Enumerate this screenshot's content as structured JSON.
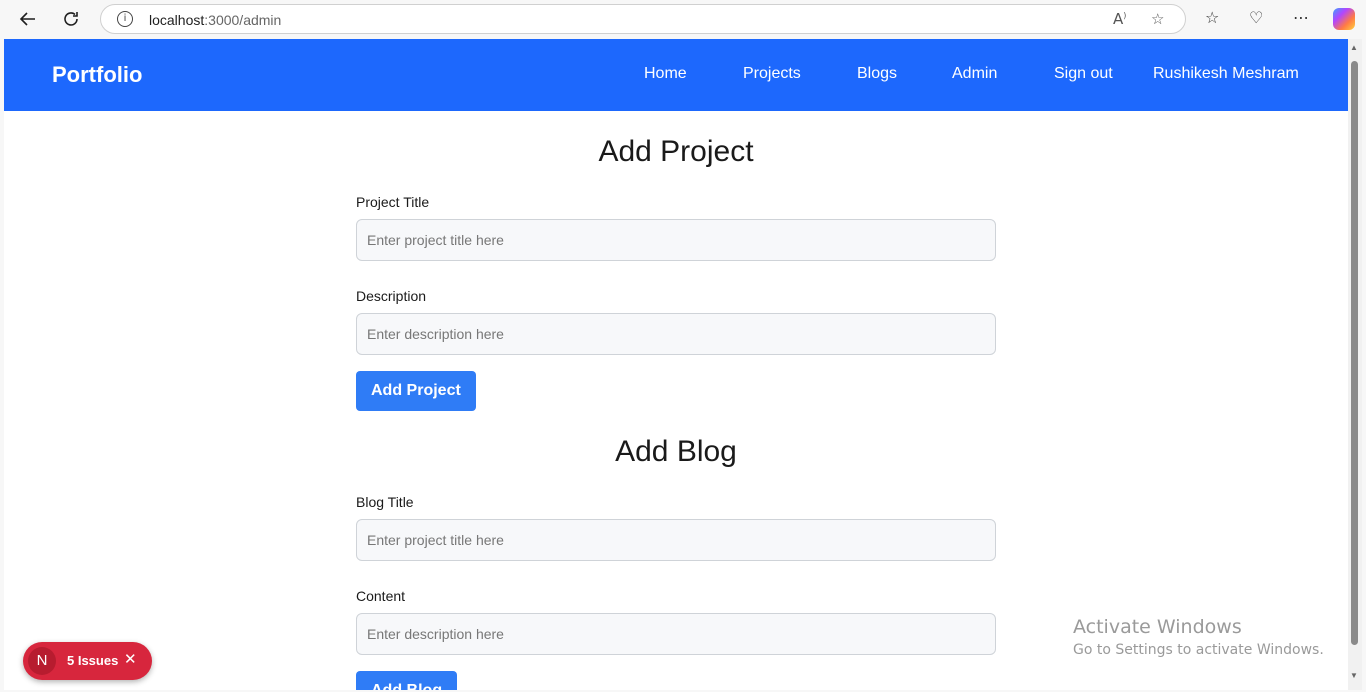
{
  "browser": {
    "url_host": "localhost",
    "url_path": ":3000/admin",
    "icons": [
      "back-arrow-icon",
      "refresh-icon",
      "info-icon",
      "read-aloud-icon",
      "favorite-star-icon",
      "favorites-icon",
      "browser-essentials-icon",
      "more-icon",
      "copilot-icon"
    ]
  },
  "navbar": {
    "brand": "Portfolio",
    "links": [
      "Home",
      "Projects",
      "Blogs",
      "Admin",
      "Sign out",
      "Rushikesh Meshram"
    ],
    "color": "#1d68fd"
  },
  "project_form": {
    "heading": "Add Project",
    "title_label": "Project Title",
    "title_placeholder": "Enter project title here",
    "description_label": "Description",
    "description_placeholder": "Enter description here",
    "submit_label": "Add Project"
  },
  "blog_form": {
    "heading": "Add Blog",
    "title_label": "Blog Title",
    "title_placeholder": "Enter project title here",
    "content_label": "Content",
    "content_placeholder": "Enter description here",
    "submit_label": "Add Blog"
  },
  "issues_badge": {
    "logo": "N",
    "text": "5 Issues",
    "color": "#d7263d"
  },
  "watermark": {
    "title": "Activate Windows",
    "subtitle": "Go to Settings to activate Windows."
  }
}
